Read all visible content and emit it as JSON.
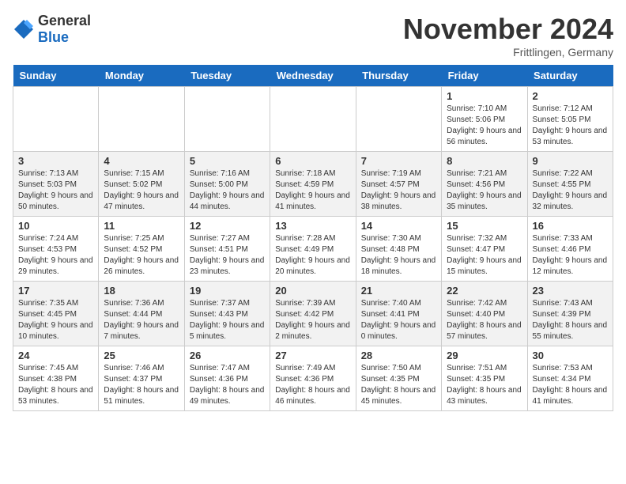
{
  "header": {
    "logo_general": "General",
    "logo_blue": "Blue",
    "title": "November 2024",
    "location": "Frittlingen, Germany"
  },
  "calendar": {
    "days_of_week": [
      "Sunday",
      "Monday",
      "Tuesday",
      "Wednesday",
      "Thursday",
      "Friday",
      "Saturday"
    ],
    "weeks": [
      [
        {
          "day": "",
          "info": ""
        },
        {
          "day": "",
          "info": ""
        },
        {
          "day": "",
          "info": ""
        },
        {
          "day": "",
          "info": ""
        },
        {
          "day": "",
          "info": ""
        },
        {
          "day": "1",
          "info": "Sunrise: 7:10 AM\nSunset: 5:06 PM\nDaylight: 9 hours and 56 minutes."
        },
        {
          "day": "2",
          "info": "Sunrise: 7:12 AM\nSunset: 5:05 PM\nDaylight: 9 hours and 53 minutes."
        }
      ],
      [
        {
          "day": "3",
          "info": "Sunrise: 7:13 AM\nSunset: 5:03 PM\nDaylight: 9 hours and 50 minutes."
        },
        {
          "day": "4",
          "info": "Sunrise: 7:15 AM\nSunset: 5:02 PM\nDaylight: 9 hours and 47 minutes."
        },
        {
          "day": "5",
          "info": "Sunrise: 7:16 AM\nSunset: 5:00 PM\nDaylight: 9 hours and 44 minutes."
        },
        {
          "day": "6",
          "info": "Sunrise: 7:18 AM\nSunset: 4:59 PM\nDaylight: 9 hours and 41 minutes."
        },
        {
          "day": "7",
          "info": "Sunrise: 7:19 AM\nSunset: 4:57 PM\nDaylight: 9 hours and 38 minutes."
        },
        {
          "day": "8",
          "info": "Sunrise: 7:21 AM\nSunset: 4:56 PM\nDaylight: 9 hours and 35 minutes."
        },
        {
          "day": "9",
          "info": "Sunrise: 7:22 AM\nSunset: 4:55 PM\nDaylight: 9 hours and 32 minutes."
        }
      ],
      [
        {
          "day": "10",
          "info": "Sunrise: 7:24 AM\nSunset: 4:53 PM\nDaylight: 9 hours and 29 minutes."
        },
        {
          "day": "11",
          "info": "Sunrise: 7:25 AM\nSunset: 4:52 PM\nDaylight: 9 hours and 26 minutes."
        },
        {
          "day": "12",
          "info": "Sunrise: 7:27 AM\nSunset: 4:51 PM\nDaylight: 9 hours and 23 minutes."
        },
        {
          "day": "13",
          "info": "Sunrise: 7:28 AM\nSunset: 4:49 PM\nDaylight: 9 hours and 20 minutes."
        },
        {
          "day": "14",
          "info": "Sunrise: 7:30 AM\nSunset: 4:48 PM\nDaylight: 9 hours and 18 minutes."
        },
        {
          "day": "15",
          "info": "Sunrise: 7:32 AM\nSunset: 4:47 PM\nDaylight: 9 hours and 15 minutes."
        },
        {
          "day": "16",
          "info": "Sunrise: 7:33 AM\nSunset: 4:46 PM\nDaylight: 9 hours and 12 minutes."
        }
      ],
      [
        {
          "day": "17",
          "info": "Sunrise: 7:35 AM\nSunset: 4:45 PM\nDaylight: 9 hours and 10 minutes."
        },
        {
          "day": "18",
          "info": "Sunrise: 7:36 AM\nSunset: 4:44 PM\nDaylight: 9 hours and 7 minutes."
        },
        {
          "day": "19",
          "info": "Sunrise: 7:37 AM\nSunset: 4:43 PM\nDaylight: 9 hours and 5 minutes."
        },
        {
          "day": "20",
          "info": "Sunrise: 7:39 AM\nSunset: 4:42 PM\nDaylight: 9 hours and 2 minutes."
        },
        {
          "day": "21",
          "info": "Sunrise: 7:40 AM\nSunset: 4:41 PM\nDaylight: 9 hours and 0 minutes."
        },
        {
          "day": "22",
          "info": "Sunrise: 7:42 AM\nSunset: 4:40 PM\nDaylight: 8 hours and 57 minutes."
        },
        {
          "day": "23",
          "info": "Sunrise: 7:43 AM\nSunset: 4:39 PM\nDaylight: 8 hours and 55 minutes."
        }
      ],
      [
        {
          "day": "24",
          "info": "Sunrise: 7:45 AM\nSunset: 4:38 PM\nDaylight: 8 hours and 53 minutes."
        },
        {
          "day": "25",
          "info": "Sunrise: 7:46 AM\nSunset: 4:37 PM\nDaylight: 8 hours and 51 minutes."
        },
        {
          "day": "26",
          "info": "Sunrise: 7:47 AM\nSunset: 4:36 PM\nDaylight: 8 hours and 49 minutes."
        },
        {
          "day": "27",
          "info": "Sunrise: 7:49 AM\nSunset: 4:36 PM\nDaylight: 8 hours and 46 minutes."
        },
        {
          "day": "28",
          "info": "Sunrise: 7:50 AM\nSunset: 4:35 PM\nDaylight: 8 hours and 45 minutes."
        },
        {
          "day": "29",
          "info": "Sunrise: 7:51 AM\nSunset: 4:35 PM\nDaylight: 8 hours and 43 minutes."
        },
        {
          "day": "30",
          "info": "Sunrise: 7:53 AM\nSunset: 4:34 PM\nDaylight: 8 hours and 41 minutes."
        }
      ]
    ]
  }
}
